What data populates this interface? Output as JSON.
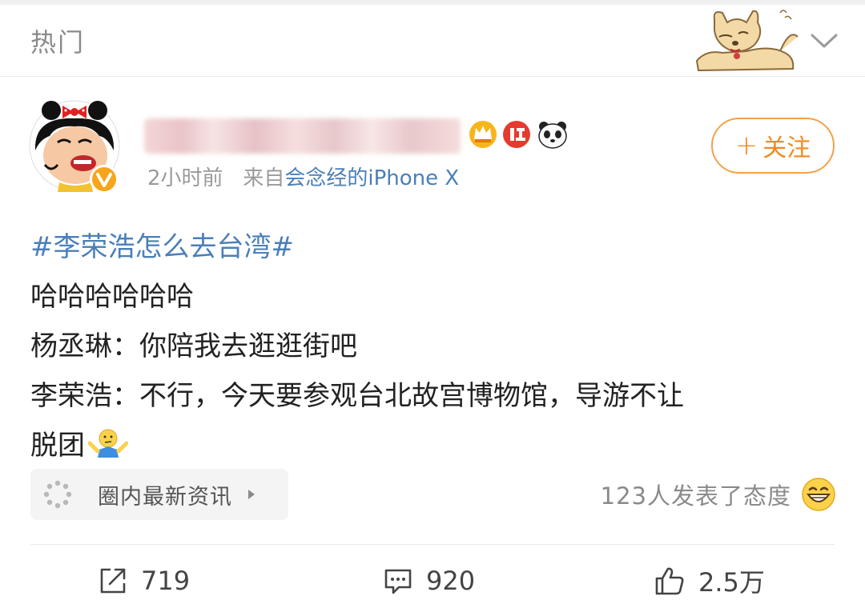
{
  "header": {
    "title": "热门"
  },
  "post": {
    "time": "2小时前",
    "source_prefix": "来自",
    "source_device": "会念经的iPhone X",
    "follow_label": "关注",
    "hashtag": "#李荣浩怎么去台湾#",
    "lines": [
      "哈哈哈哈哈哈",
      "杨丞琳：你陪我去逛逛街吧",
      "李荣浩：不行，今天要参观台北故宫博物馆，导游不让",
      "脱团"
    ],
    "badges": [
      "crown-badge-icon",
      "red-badge-icon",
      "panda-badge-icon"
    ]
  },
  "circle_tag": {
    "label": "圈内最新资讯"
  },
  "reactions": {
    "text": "123人发表了态度"
  },
  "actions": {
    "repost_count": "719",
    "comment_count": "920",
    "like_count": "2.5万"
  },
  "colors": {
    "link": "#4a7fb8",
    "follow": "#f08a20",
    "muted": "#9a9a9a"
  }
}
